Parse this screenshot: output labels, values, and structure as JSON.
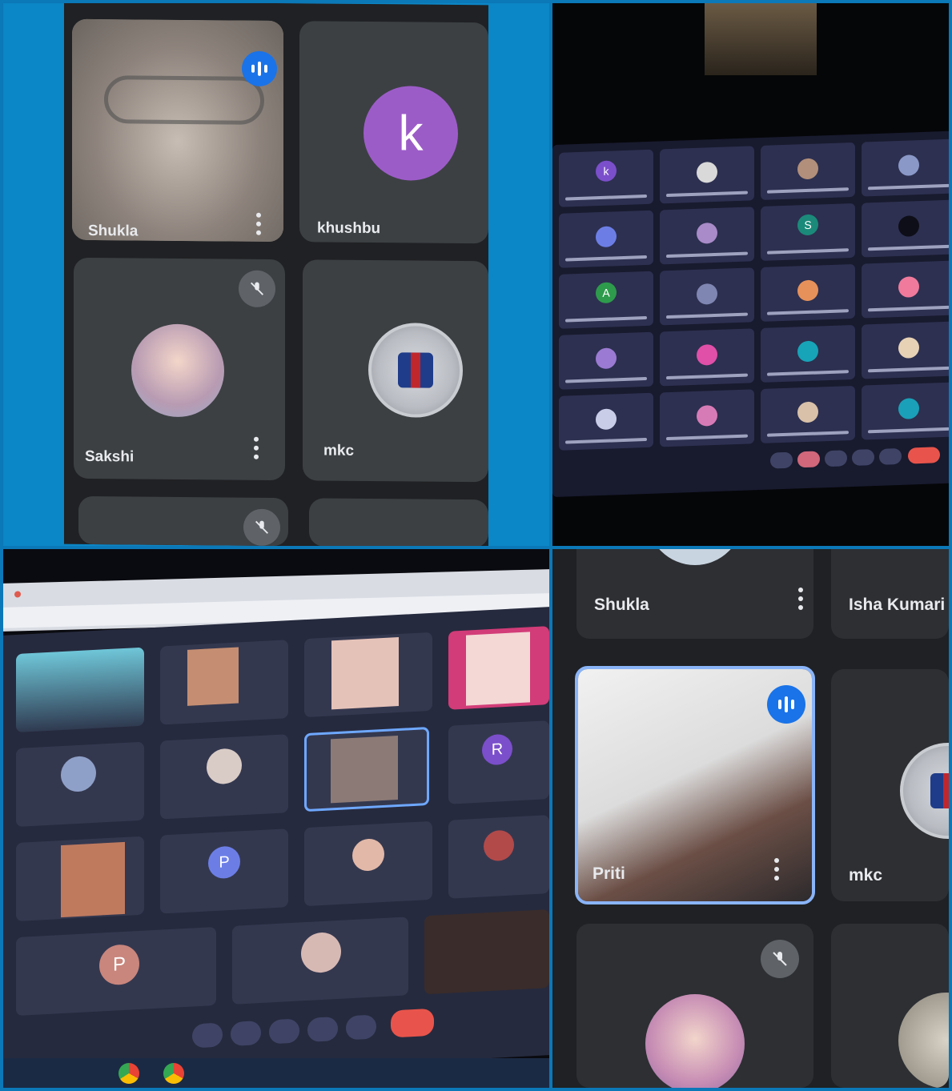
{
  "q1": {
    "tiles": [
      {
        "name": "Shukla"
      },
      {
        "name": "khushbu",
        "initial": "k"
      },
      {
        "name": "Sakshi"
      },
      {
        "name": "mkc"
      }
    ]
  },
  "q4": {
    "tiles": [
      {
        "name": "Shukla"
      },
      {
        "name": "Isha Kumari"
      },
      {
        "name": "Priti"
      },
      {
        "name": "mkc"
      }
    ]
  },
  "q3": {
    "avatar_p1": "P",
    "avatar_r": "R",
    "avatar_p2": "P"
  },
  "q2": {
    "avatar_k": "k",
    "avatar_a": "A",
    "avatar_s": "S"
  },
  "colors": {
    "meet_blue": "#1a73e8",
    "tile_bg": "#3c4043",
    "purple_avatar": "#9c5cc8"
  }
}
